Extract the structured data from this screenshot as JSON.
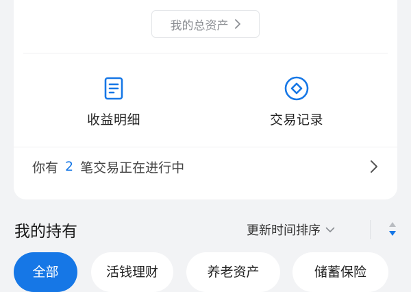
{
  "overview": {
    "total_assets_label": "我的总资产"
  },
  "actions": {
    "income": {
      "label": "收益明细",
      "icon": "document-list-icon",
      "color": "#1677e6"
    },
    "trades": {
      "label": "交易记录",
      "icon": "diamond-circle-icon",
      "color": "#1677e6"
    }
  },
  "notice": {
    "prefix": "你有",
    "count": "2",
    "suffix": "笔交易正在进行中"
  },
  "holdings": {
    "title": "我的持有",
    "sort_label": "更新时间排序",
    "filters": [
      "全部",
      "活钱理财",
      "养老资产",
      "储蓄保险"
    ],
    "active_filter": "全部"
  },
  "colors": {
    "accent": "#1677e6",
    "background": "#f2f3f5",
    "card": "#ffffff"
  }
}
